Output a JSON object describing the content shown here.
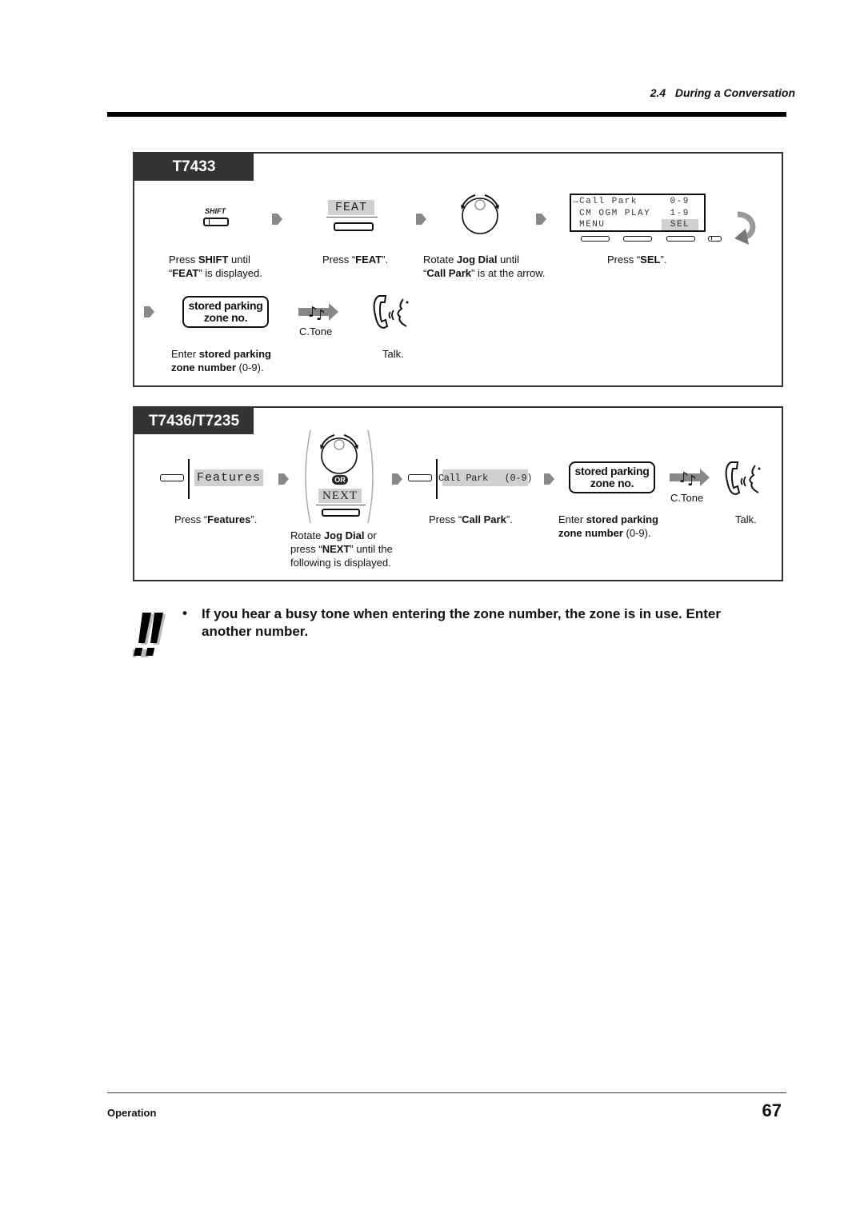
{
  "header": {
    "section": "2.4   During a Conversation"
  },
  "panel1": {
    "tab_label": "T7433",
    "shift_key_label": "SHIFT",
    "feat_key_label": "FEAT",
    "lcd_lines": [
      "→Call Park     0-9",
      " CM OGM PLAY   1-9",
      " MENU"
    ],
    "lcd_sel_label": "SEL",
    "steps": {
      "shift": {
        "pre": "Press ",
        "bold": "SHIFT",
        "post": " until",
        "line2_q1": "“",
        "line2_bold": "FEAT",
        "line2_post": "” is displayed."
      },
      "feat": {
        "pre": "Press “",
        "bold": "FEAT",
        "post": "”."
      },
      "jog": {
        "pre": "Rotate ",
        "bold": "Jog Dial",
        "post": " until",
        "line2_q1": "“",
        "line2_bold": "Call Park",
        "line2_post": "” is at the arrow."
      },
      "sel": {
        "pre": "Press “",
        "bold": "SEL",
        "post": "”."
      },
      "zone": {
        "pre": "Enter ",
        "bold": "stored parking",
        "line2_bold": "zone number",
        "line2_post": " (0-9)."
      },
      "talk": "Talk."
    },
    "zone_box_line1": "stored parking",
    "zone_box_line2": "zone no.",
    "ctone_label": "C.Tone"
  },
  "panel2": {
    "tab_label": "T7436/T7235",
    "features_label": "Features",
    "or_label": "OR",
    "next_label": "NEXT",
    "callpark_label": "Call Park   (0-9)",
    "zone_box_line1": "stored parking",
    "zone_box_line2": "zone no.",
    "ctone_label": "C.Tone",
    "steps": {
      "features": {
        "pre": "Press “",
        "bold": "Features",
        "post": "”."
      },
      "jog": {
        "pre": "Rotate ",
        "bold": "Jog Dial",
        "post": " or",
        "line2_pre": "press “",
        "line2_bold": "NEXT",
        "line2_post": "” until the",
        "line3": "following is displayed."
      },
      "callpark": {
        "pre": "Press “",
        "bold": "Call Park",
        "post": "”."
      },
      "zone": {
        "pre": "Enter ",
        "bold": "stored parking",
        "line2_bold": "zone number",
        "line2_post": " (0-9)."
      },
      "talk": "Talk."
    }
  },
  "note": {
    "icon": "double-exclamation-icon",
    "bullet": "•",
    "text": "If you hear a busy tone when entering the zone number, the zone is in use. Enter another number."
  },
  "footer": {
    "section": "Operation",
    "page_number": "67"
  }
}
